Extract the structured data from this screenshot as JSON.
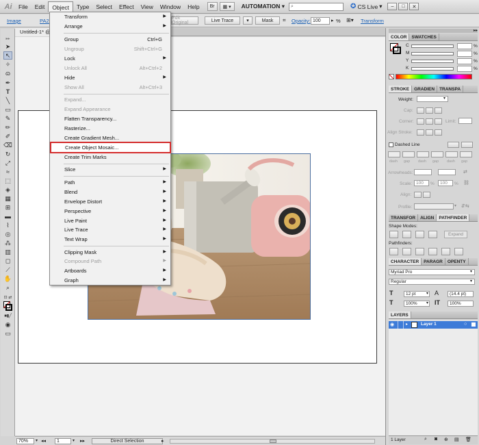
{
  "menubar": {
    "logo": "Ai",
    "items": [
      "File",
      "Edit",
      "Object",
      "Type",
      "Select",
      "Effect",
      "View",
      "Window",
      "Help"
    ],
    "workspace": "AUTOMATION",
    "search_placeholder": "",
    "cslive": "CS Live"
  },
  "controlbar": {
    "image_label": "Image",
    "filename": "PA22",
    "edit_original": "Edit Original",
    "live_trace": "Live Trace",
    "mask": "Mask",
    "opacity_label": "Opacity:",
    "opacity_value": "100",
    "opacity_unit": "%",
    "transform": "Transform"
  },
  "document": {
    "tab_title": "Untitled-1* @"
  },
  "object_menu": {
    "items": [
      {
        "label": "Transform",
        "submenu": true
      },
      {
        "label": "Arrange",
        "submenu": true
      },
      {
        "label": "Group",
        "shortcut": "Ctrl+G"
      },
      {
        "label": "Ungroup",
        "shortcut": "Shift+Ctrl+G",
        "disabled": true
      },
      {
        "label": "Lock",
        "submenu": true
      },
      {
        "label": "Unlock All",
        "shortcut": "Alt+Ctrl+2",
        "disabled": true
      },
      {
        "label": "Hide",
        "submenu": true
      },
      {
        "label": "Show All",
        "shortcut": "Alt+Ctrl+3",
        "disabled": true
      },
      {
        "label": "Expand...",
        "disabled": true
      },
      {
        "label": "Expand Appearance",
        "disabled": true
      },
      {
        "label": "Flatten Transparency..."
      },
      {
        "label": "Rasterize..."
      },
      {
        "label": "Create Gradient Mesh..."
      },
      {
        "label": "Create Object Mosaic...",
        "highlighted": true
      },
      {
        "label": "Create Trim Marks"
      },
      {
        "label": "Slice",
        "submenu": true
      },
      {
        "label": "Path",
        "submenu": true
      },
      {
        "label": "Blend",
        "submenu": true
      },
      {
        "label": "Envelope Distort",
        "submenu": true
      },
      {
        "label": "Perspective",
        "submenu": true
      },
      {
        "label": "Live Paint",
        "submenu": true
      },
      {
        "label": "Live Trace",
        "submenu": true
      },
      {
        "label": "Text Wrap",
        "submenu": true
      },
      {
        "label": "Clipping Mask",
        "submenu": true
      },
      {
        "label": "Compound Path",
        "submenu": true,
        "disabled": true
      },
      {
        "label": "Artboards",
        "submenu": true
      },
      {
        "label": "Graph",
        "submenu": true
      }
    ],
    "submenu_arrow": "▶",
    "highlight_color": "#d42b2b"
  },
  "statusbar": {
    "zoom": "70%",
    "page": "1",
    "tool": "Direct Selection"
  },
  "panels": {
    "color": {
      "tabs": [
        "COLOR",
        "SWATCHES"
      ],
      "channels": [
        "C",
        "M",
        "Y",
        "K"
      ],
      "unit": "%"
    },
    "stroke": {
      "tabs": [
        "STROKE",
        "GRADIEN",
        "TRANSPA"
      ],
      "weight_label": "Weight:",
      "cap_label": "Cap:",
      "corner_label": "Corner:",
      "limit_label": "Limit:",
      "align_label": "Align Stroke:",
      "dashed_label": "Dashed Line",
      "dash_labels": [
        "dash",
        "gap",
        "dash",
        "gap",
        "dash",
        "gap"
      ],
      "arrowheads_label": "Arrowheads:",
      "scale_label": "Scale:",
      "scale_unit": "%",
      "scale_1": "100",
      "scale_2": "100",
      "align2_label": "Align:",
      "profile_label": "Profile:"
    },
    "pathfinder": {
      "tabs": [
        "TRANSFOR",
        "ALIGN",
        "PATHFINDER"
      ],
      "shape_modes": "Shape Modes:",
      "expand": "Expand",
      "pathfinders": "Pathfinders:"
    },
    "character": {
      "tabs": [
        "CHARACTER",
        "PARAGR",
        "OPENTY"
      ],
      "font": "Myriad Pro",
      "style": "Regular",
      "size": "12 pt",
      "leading": "(14.4 pt)",
      "hscale": "100%",
      "vscale": "100%"
    },
    "layers": {
      "tabs": [
        "LAYERS"
      ],
      "layer_name": "Layer 1",
      "footer": "1 Layer"
    }
  },
  "colors": {
    "menu_highlight": "#d42b2b",
    "layer_selected": "#3d7bd8",
    "link_blue": "#1a5fb4"
  }
}
